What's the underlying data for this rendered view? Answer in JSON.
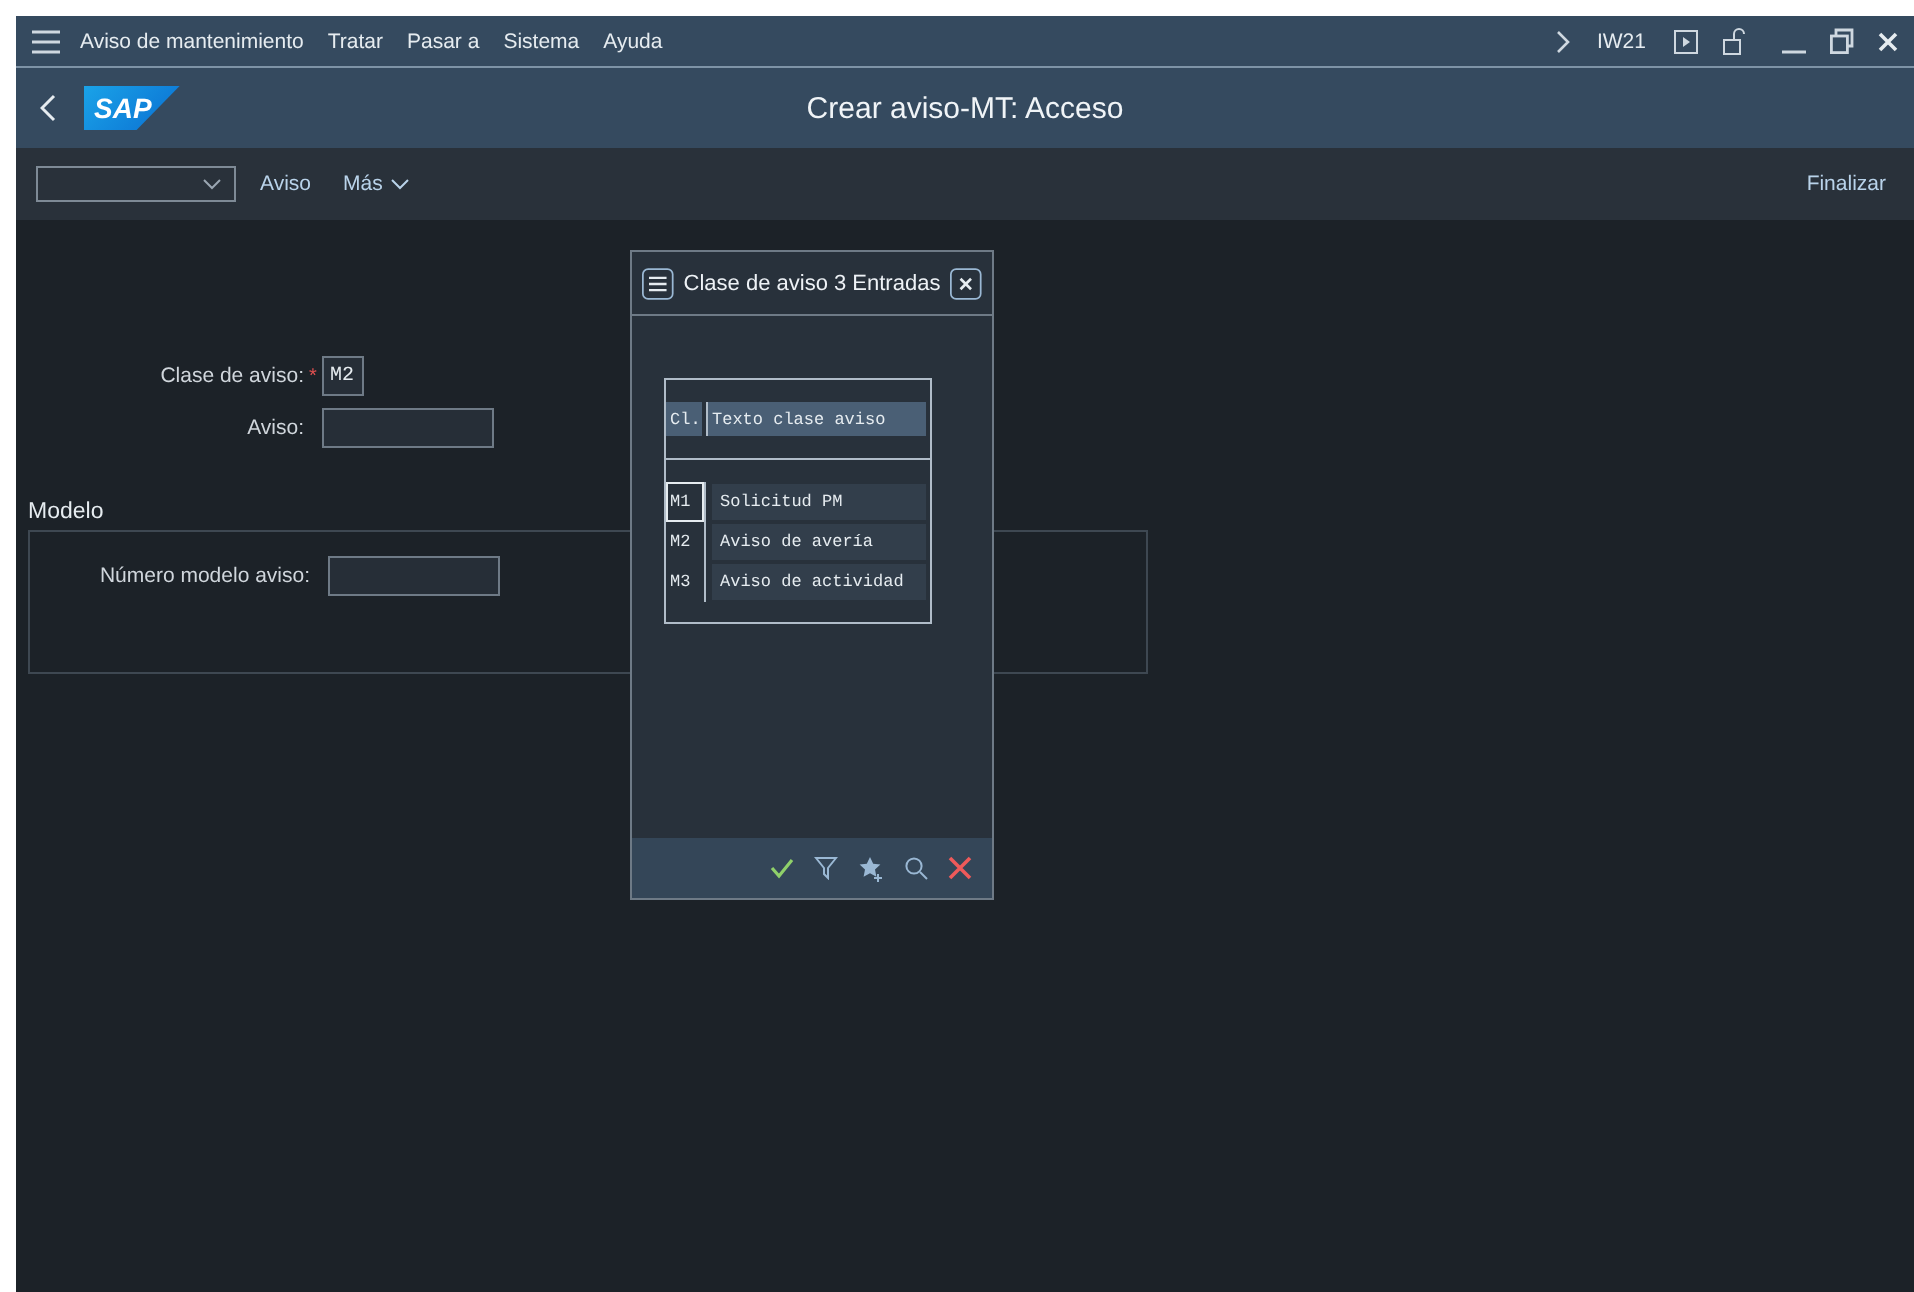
{
  "menu_bar": {
    "items": [
      "Aviso de mantenimiento",
      "Tratar",
      "Pasar a",
      "Sistema",
      "Ayuda"
    ],
    "transaction": "IW21"
  },
  "title_bar": {
    "logo": "SAP",
    "title": "Crear aviso-MT: Acceso"
  },
  "toolbar": {
    "buttons": [
      "Aviso",
      "Más"
    ],
    "exit": "Finalizar"
  },
  "form": {
    "required_mark": "*",
    "fields": [
      {
        "label": "Clase de aviso:",
        "required": true,
        "value": "M2",
        "kind": "short"
      },
      {
        "label": "Aviso:",
        "required": false,
        "kind": "long"
      }
    ]
  },
  "model_section": {
    "title": "Modelo",
    "fields": [
      {
        "label": "Número modelo aviso:",
        "required": false,
        "kind": "long"
      }
    ]
  },
  "dialog": {
    "title": "Clase de aviso 3 Entradas",
    "columns": [
      "Cl.",
      "Texto clase aviso"
    ],
    "rows": [
      {
        "code": "M1",
        "text": "Solicitud PM",
        "focused": true
      },
      {
        "code": "M2",
        "text": "Aviso de avería",
        "focused": false
      },
      {
        "code": "M3",
        "text": "Aviso de actividad",
        "focused": false
      }
    ]
  }
}
